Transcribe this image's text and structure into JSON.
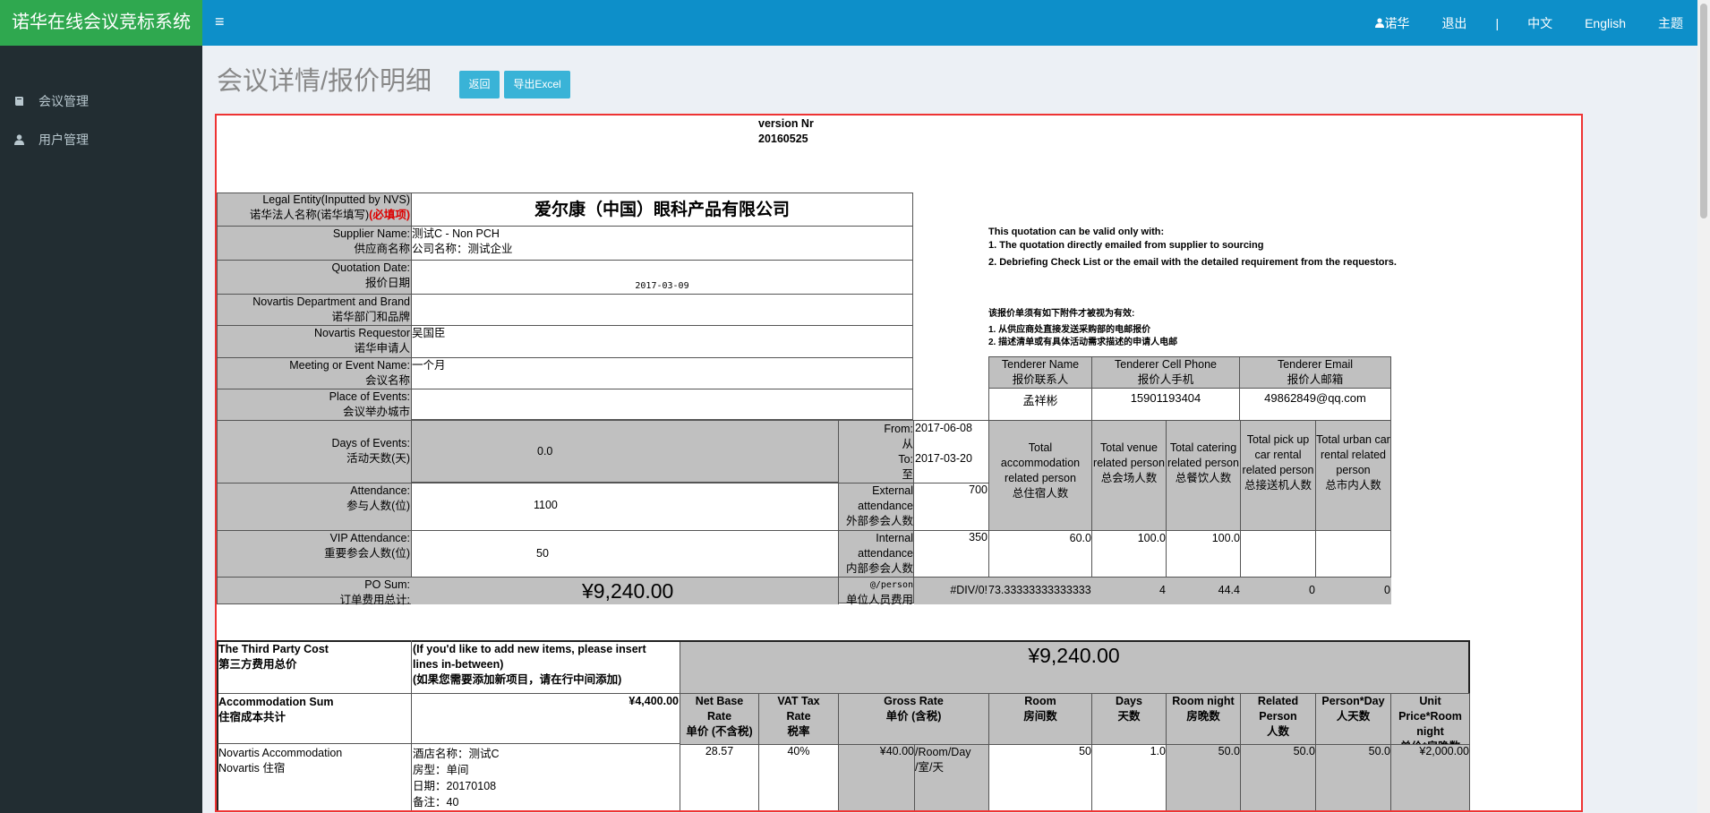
{
  "app": {
    "brand": "诺华在线会议竞标系统",
    "menu_icon": "≡",
    "user": "诺华",
    "logout": "退出",
    "separator": "|",
    "lang_zh": "中文",
    "lang_en": "English",
    "theme": "主题"
  },
  "sidebar": {
    "items": [
      {
        "label": "会议管理",
        "icon": "book-icon"
      },
      {
        "label": "用户管理",
        "icon": "user-icon"
      }
    ]
  },
  "page": {
    "title": "会议详情/报价明细",
    "back_button": "返回",
    "export_button": "导出Excel"
  },
  "sheet": {
    "version_label": "version Nr",
    "version_value": "20160525",
    "legal_entity_en": "Legal Entity(Inputted by NVS)",
    "legal_entity_cn": "诺华法人名称(诺华填写)",
    "required": "(必填项)",
    "legal_entity_value": "爱尔康（中国）眼科产品有限公司",
    "supplier_en": "Supplier Name:",
    "supplier_cn": "供应商名称",
    "supplier_value1": "测试C - Non PCH",
    "supplier_value2": "公司名称：测试企业",
    "quote_date_en": "Quotation Date:",
    "quote_date_cn": "报价日期",
    "quote_date_value": "2017-03-09",
    "dept_en": "Novartis Department and Brand",
    "dept_cn": "诺华部门和品牌",
    "requestor_en": "Novartis Requestor",
    "requestor_cn": "诺华申请人",
    "requestor_value": "吴国臣",
    "event_en": "Meeting or Event Name:",
    "event_cn": "会议名称",
    "event_value": "一个月",
    "place_en": "Place of Events:",
    "place_cn": "会议举办城市",
    "days_en": "Days of Events:",
    "days_cn": "活动天数(天)",
    "days_value": "0.0",
    "from_en": "From:",
    "from_cn": "从",
    "from_value": "2017-06-08",
    "to_en": "To:",
    "to_cn": "至",
    "to_value": "2017-03-20",
    "attendance_en": "Attendance:",
    "attendance_cn": "参与人数(位)",
    "attendance_value": "1100",
    "external_en1": "External",
    "external_en2": "attendance",
    "external_cn": "外部参会人数",
    "external_value": "700",
    "vip_en": "VIP Attendance:",
    "vip_cn": "重要参会人数(位)",
    "vip_value": "50",
    "internal_en1": "Internal",
    "internal_en2": "attendance",
    "internal_cn": "内部参会人数",
    "internal_value": "350",
    "po_en": "PO Sum:",
    "po_cn": "订单费用总计:",
    "po_value": "¥9,240.00",
    "per_person_en": "@/person",
    "per_person_cn": "单位人员费用",
    "per_person_value": "#DIV/0!",
    "note_en_title": "This quotation can be valid only with:",
    "note_en_1": "1. The quotation directly emailed from supplier to sourcing",
    "note_en_2": "2. Debriefing Check List or the email with the detailed requirement from the requestors.",
    "note_cn_title": "该报价单须有如下附件才被视为有效:",
    "note_cn_1": "1. 从供应商处直接发送采购部的电邮报价",
    "note_cn_2": "2. 描述清单或有具体活动需求描述的申请人电邮",
    "tender_name_en": "Tenderer Name",
    "tender_name_cn": "报价联系人",
    "tender_name_value": "孟祥彬",
    "tender_phone_en": "Tenderer Cell Phone",
    "tender_phone_cn": "报价人手机",
    "tender_phone_value": "15901193404",
    "tender_email_en": "Tenderer Email",
    "tender_email_cn": "报价人邮箱",
    "tender_email_value": "49862849@qq.com",
    "tot_acc": "Total accommodation related person",
    "tot_acc_cn": "总住宿人数",
    "tot_venue": "Total venue related person",
    "tot_venue_cn": "总会场人数",
    "tot_cat": "Total catering related person",
    "tot_cat_cn": "总餐饮人数",
    "tot_pick": "Total pick up car rental related person",
    "tot_pick_cn": "总接送机人数",
    "tot_urban": "Total urban car rental related person",
    "tot_urban_cn": "总市内人数",
    "int_acc": "60.0",
    "int_venue": "100.0",
    "int_cat": "100.0",
    "pp_acc": "73.33333333333333",
    "pp_venue": "4",
    "pp_cat": "44.4",
    "pp_pick": "0",
    "pp_urban": "0",
    "third_en": "The Third Party Cost",
    "third_cn": "第三方费用总价",
    "insert_note1": "(If you'd like to add new items, please insert",
    "insert_note2": "lines in-between)",
    "insert_note3": "(如果您需要添加新项目，请在行中间添加)",
    "third_value": "¥9,240.00",
    "acc_sum_en": "Accommodation Sum",
    "acc_sum_cn": "住宿成本共计",
    "acc_sum_value": "¥4,400.00",
    "h_net1": "Net Base",
    "h_net2": "Rate",
    "h_net3": "单价 (不含税)",
    "h_vat1": "VAT Tax",
    "h_vat2": "Rate",
    "h_vat3": "税率",
    "h_gross1": "Gross Rate",
    "h_gross2": "单价 (含税)",
    "h_room1": "Room",
    "h_room2": "房间数",
    "h_days1": "Days",
    "h_days2": "天数",
    "h_rn1": "Room night",
    "h_rn2": "房晚数",
    "h_rel1": "Related",
    "h_rel2": "Person",
    "h_rel3": "人数",
    "h_pd1": "Person*Day",
    "h_pd2": "人天数",
    "h_up1": "Unit Price*Room",
    "h_up2": "night",
    "h_up3": "单价*房晚数",
    "row_label1": "Novartis Accommodation",
    "row_label2": "Novartis 住宿",
    "row_d1": "酒店名称：测试C",
    "row_d2": "房型：单间",
    "row_d3": "日期：20170108",
    "row_d4": "备注：40",
    "row_net": "28.57",
    "row_vat": "40%",
    "row_gross": "¥40.00",
    "row_unit1": "/Room/Day",
    "row_unit2": "/室/天",
    "row_room": "50",
    "row_days": "1.0",
    "row_rn": "50.0",
    "row_rel": "50.0",
    "row_pd": "50.0",
    "row_up": "¥2,000.00"
  }
}
